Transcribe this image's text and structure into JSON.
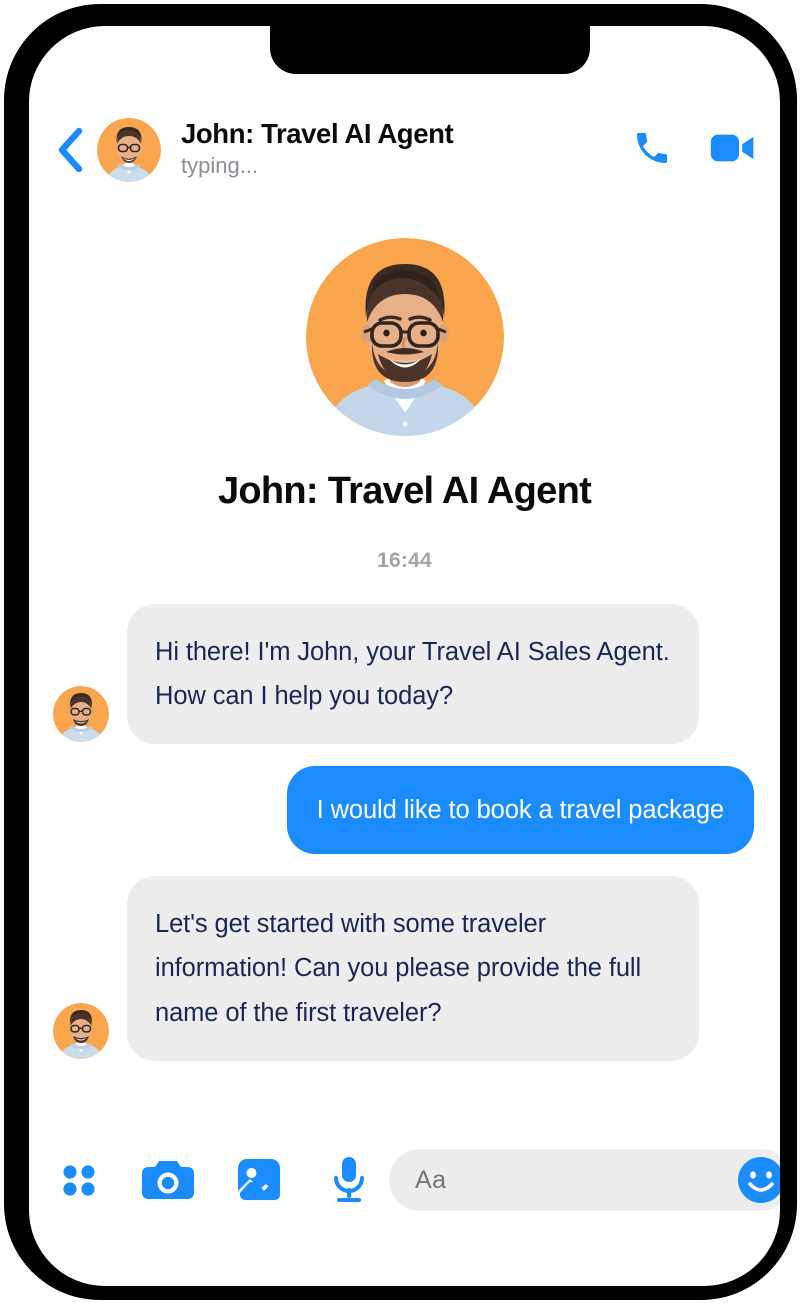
{
  "header": {
    "title": "John: Travel AI Agent",
    "status": "typing...",
    "back_icon": "chevron-left-icon",
    "call_icon": "phone-icon",
    "video_icon": "video-camera-icon"
  },
  "intro": {
    "name": "John: Travel AI Agent",
    "avatar_label": "john-profile-avatar"
  },
  "conversation": {
    "timestamp": "16:44",
    "messages": [
      {
        "id": "msg-1",
        "direction": "incoming",
        "sender": "John: Travel AI Agent",
        "text": "Hi there! I'm John, your Travel AI Sales Agent. How can I help you today?"
      },
      {
        "id": "msg-2",
        "direction": "outgoing",
        "sender": "You",
        "text": "I would like to book a travel package"
      },
      {
        "id": "msg-3",
        "direction": "incoming",
        "sender": "John: Travel AI Agent",
        "text": "Let's get started with some traveler information! Can you please provide the full name of the first traveler?"
      }
    ]
  },
  "composer": {
    "placeholder": "Aa",
    "value": "",
    "actions": [
      {
        "name": "more-apps-icon",
        "label": "More"
      },
      {
        "name": "camera-icon",
        "label": "Camera"
      },
      {
        "name": "image-gallery-icon",
        "label": "Gallery"
      },
      {
        "name": "microphone-icon",
        "label": "Voice message"
      }
    ],
    "emoji_icon": "smiley-face-icon",
    "like_icon": "thumbs-up-icon"
  },
  "colors": {
    "accent_blue": "#1b8cfd",
    "incoming_bubble": "#ededed",
    "incoming_text": "#1c2656",
    "outgoing_text": "#ffffff",
    "muted_text": "#8d8d94",
    "timestamp_text": "#a3a3ab",
    "avatar_bg": "#f9a council",
    "frame": "#000000",
    "screen": "#ffffff"
  }
}
